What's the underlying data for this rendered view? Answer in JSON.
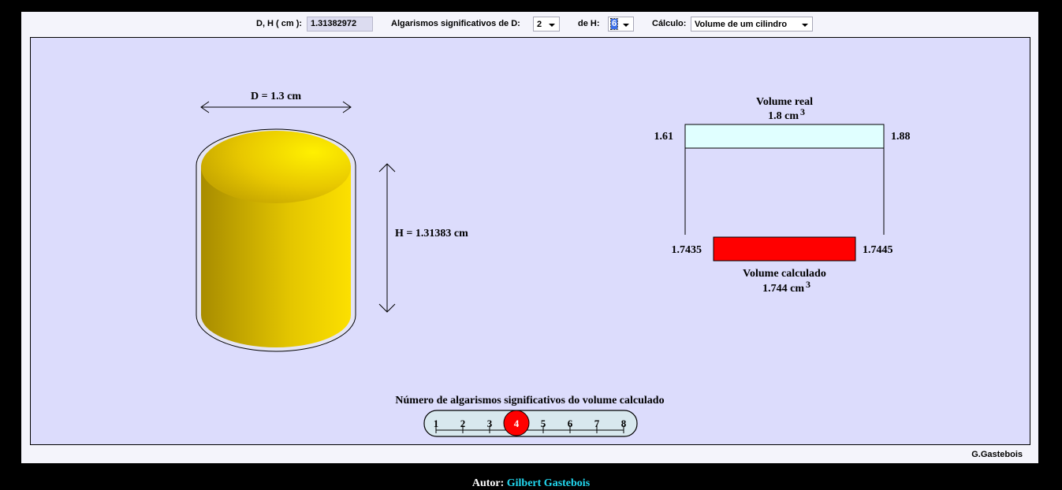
{
  "controls": {
    "dh_label": "D, H ( cm ):",
    "dh_value": "1.31382972",
    "sig_label": "Algarismos significativos de  D:",
    "sig_d_value": "2",
    "de_h_label": "de  H:",
    "sig_h_value": "6",
    "calc_label": "Cálculo:",
    "calc_value": "Volume de um cilindro"
  },
  "cylinder": {
    "diameter_label": "D = 1.3 cm",
    "height_label": "H = 1.31383 cm",
    "fill_color": "#e8c800"
  },
  "volume_real": {
    "title": "Volume real",
    "value": "1.8 cm",
    "exponent": "3",
    "min": "1.61",
    "max": "1.88",
    "bar_color": "#e0ffff"
  },
  "volume_calc": {
    "title": "Volume calculado",
    "value": "1.744 cm",
    "exponent": "3",
    "min": "1.7435",
    "max": "1.7445",
    "bar_color": "#ff0000"
  },
  "slider": {
    "title": "Número de algarismos significativos do volume calculado",
    "ticks": [
      "1",
      "2",
      "3",
      "4",
      "5",
      "6",
      "7",
      "8"
    ],
    "selected": 4,
    "knob_color": "#ff0000"
  },
  "credit": "G.Gastebois",
  "author": {
    "label": "Autor:",
    "name": "Gilbert Gastebois"
  }
}
